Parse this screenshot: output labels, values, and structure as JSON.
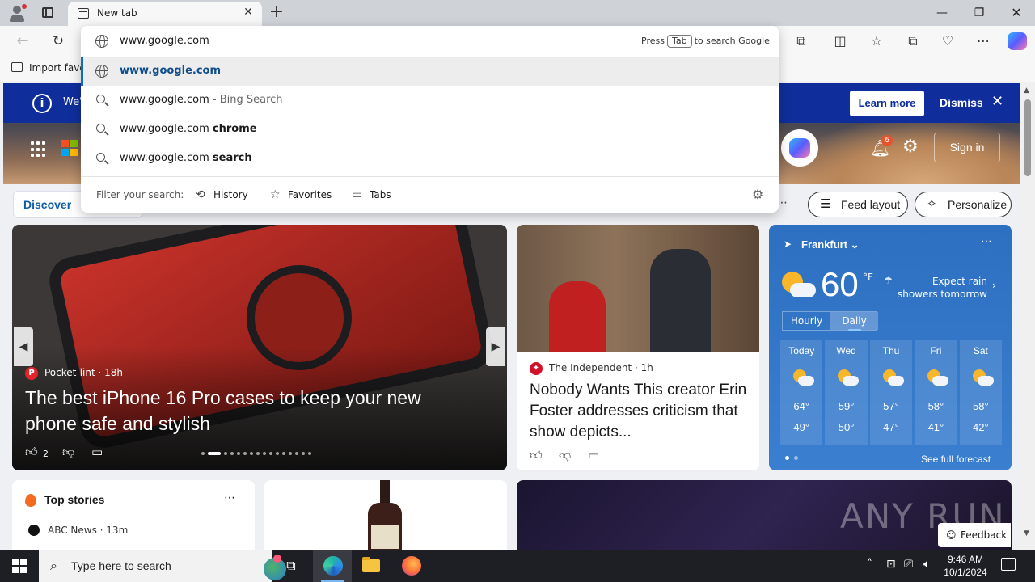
{
  "browser": {
    "tab_title": "New tab",
    "tab_close": "✕",
    "new_tab": "+",
    "window": {
      "minimize": "—",
      "maximize": "❐",
      "close": "✕"
    },
    "nav": {
      "back": "←",
      "reload": "↻"
    },
    "toolbar_icons": [
      "extensions-icon",
      "split-screen-icon",
      "favorites-icon",
      "collections-icon",
      "browser-essentials-icon",
      "more-icon",
      "copilot-icon"
    ],
    "favorites_bar": {
      "import_label": "Import favo"
    }
  },
  "omnibox": {
    "value": "www.google.com",
    "hint_before": "Press",
    "hint_key": "Tab",
    "hint_after": "to search Google",
    "suggestions": [
      {
        "icon": "globe-icon",
        "text": "www.google.com",
        "selected": true
      },
      {
        "icon": "search-icon",
        "text": "www.google.com",
        "suffix": " - Bing Search"
      },
      {
        "icon": "search-icon",
        "text": "www.google.com ",
        "bold": "chrome"
      },
      {
        "icon": "search-icon",
        "text": "www.google.com ",
        "bold": "search"
      }
    ],
    "filter": {
      "label": "Filter your search:",
      "history": "History",
      "favorites": "Favorites",
      "tabs": "Tabs"
    }
  },
  "infobar": {
    "text": "We'",
    "learn_more": "Learn more",
    "dismiss": "Dismiss"
  },
  "header": {
    "notification_count": "6",
    "sign_in": "Sign in"
  },
  "feed_nav": {
    "discover": "Discover",
    "more": "⋯",
    "feed_layout": "Feed layout",
    "personalize": "Personalize"
  },
  "main_story": {
    "source": "Pocket-lint · 18h",
    "headline": "The best iPhone 16 Pro cases to keep your new phone safe and stylish",
    "likes": "2",
    "dot_count": 16,
    "active_dot": 1
  },
  "side_story": {
    "source": "The Independent · 1h",
    "headline": "Nobody Wants This creator Erin Foster addresses criticism that show depicts..."
  },
  "weather": {
    "city": "Frankfurt",
    "temp": "60",
    "unit": "°F",
    "forecast": "Expect rain showers tomorrow",
    "tabs": [
      "Hourly",
      "Daily"
    ],
    "active_tab": "Daily",
    "days": [
      {
        "name": "Today",
        "hi": "64°",
        "lo": "49°"
      },
      {
        "name": "Wed",
        "hi": "59°",
        "lo": "50°"
      },
      {
        "name": "Thu",
        "hi": "57°",
        "lo": "47°"
      },
      {
        "name": "Fri",
        "hi": "58°",
        "lo": "41°"
      },
      {
        "name": "Sat",
        "hi": "58°",
        "lo": "42°"
      }
    ],
    "full_forecast": "See full forecast"
  },
  "top_stories": {
    "title": "Top stories",
    "source": "ABC News · 13m"
  },
  "watermark": "ANY RUN",
  "feedback": "Feedback",
  "taskbar": {
    "search_placeholder": "Type here to search",
    "time": "9:46 AM",
    "date": "10/1/2024"
  }
}
